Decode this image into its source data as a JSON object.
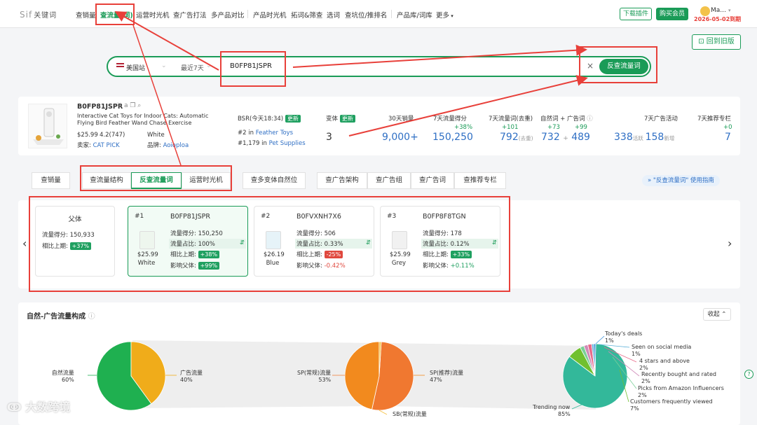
{
  "topbar": {
    "logo": "Sif",
    "logo_sub": "关键词",
    "nav": [
      "查销量",
      "查流量(词)",
      "运营时光机",
      "查广告打法",
      "多产品对比",
      "产品时光机",
      "拓词&筛查",
      "选词",
      "查坑位/推排名",
      "产品库/词库",
      "更多"
    ],
    "download": "下载插件",
    "buy": "购买会员",
    "user": "Ma...",
    "expire": "2026-05-02到期"
  },
  "back_old": "回到旧版",
  "search": {
    "site": "美国站",
    "range": "最近7天",
    "asin": "B0FP81JSPR",
    "submit": "反查流量词"
  },
  "product": {
    "asin": "B0FP81JSPR",
    "title": "Interactive Cat Toys for Indoor Cats: Automatic Flying Bird Feather Wand Chase Exercise Enrichment...",
    "price": "$25.99",
    "rating": "4.2(747)",
    "color": "White",
    "seller_label": "卖家:",
    "seller": "CAT PICK",
    "brand_label": "品牌:",
    "brand": "Aoioploa",
    "bsr_label": "BSR(今天18:34)",
    "bsr_update": "更新",
    "bsr1_rank": "#2",
    "bsr1_in": "in",
    "bsr1_cat": "Feather Toys",
    "bsr2_rank": "#1,179",
    "bsr2_in": "in",
    "bsr2_cat": "Pet Supplies",
    "variants_label": "变体",
    "variants_update": "更新",
    "variants": "3",
    "sales_label": "30天销量",
    "sales": "9,000+",
    "score_label": "7天流量得分",
    "score_change": "+38%",
    "score": "150,250",
    "kw_label": "7天流量词(去重)",
    "kw_change": "+101",
    "kw": "792",
    "kw_unit": "(去重)",
    "nat_label": "自然词 + 广告词",
    "nat_change": "+73",
    "ad_change": "+99",
    "nat": "732",
    "plus": "+",
    "ad": "489",
    "adact_label": "7天广告活动",
    "active": "338",
    "active_unit": "活跃",
    "new": "158",
    "new_unit": "新增",
    "rec_label": "7天推荐专栏",
    "rec_change": "+0",
    "rec": "7"
  },
  "tabs": [
    "查销量",
    "查流量结构",
    "反查流量词",
    "运营时光机",
    "查多变体自然位",
    "查广告架构",
    "查广告组",
    "查广告词",
    "查推荐专栏"
  ],
  "guide": "\"反查流量词\" 使用指南",
  "cards": {
    "parent": {
      "title": "父体",
      "score_label": "流量得分:",
      "score": "150,933",
      "cmp_label": "相比上期:",
      "cmp": "+37%"
    },
    "items": [
      {
        "idx": "#1",
        "asin": "B0FP81JSPR",
        "price": "$25.99",
        "color": "White",
        "score": "150,250",
        "share": "100%",
        "cmp": "+38%",
        "cmp_neg": false,
        "impact": "+99%",
        "impact_type": "pill"
      },
      {
        "idx": "#2",
        "asin": "B0FVXNH7X6",
        "price": "$26.19",
        "color": "Blue",
        "score": "506",
        "share": "0.33%",
        "cmp": "-25%",
        "cmp_neg": true,
        "impact": "-0.42%",
        "impact_type": "red"
      },
      {
        "idx": "#3",
        "asin": "B0FP8F8TGN",
        "price": "$25.99",
        "color": "Grey",
        "score": "178",
        "share": "0.12%",
        "cmp": "+33%",
        "cmp_neg": false,
        "impact": "+0.11%",
        "impact_type": "green"
      }
    ],
    "labels": {
      "score": "流量得分:",
      "share": "流量占比:",
      "cmp": "相比上期:",
      "impact": "影响父体:"
    }
  },
  "section": {
    "title": "自然-广告流量构成",
    "collapse": "收起"
  },
  "chart_data": [
    {
      "type": "pie",
      "slices": [
        {
          "label": "自然流量",
          "value": 60,
          "color": "#1fb050"
        },
        {
          "label": "广告流量",
          "value": 40,
          "color": "#f0ac1a"
        }
      ]
    },
    {
      "type": "pie",
      "slices": [
        {
          "label": "SP(常规)流量",
          "value": 53,
          "color": "#f07830"
        },
        {
          "label": "SP(推荐)流量",
          "value": 47,
          "color": "#f28a1e"
        },
        {
          "label": "SB(常规)流量",
          "value": 1,
          "color": "#f5c040"
        }
      ]
    },
    {
      "type": "pie",
      "slices": [
        {
          "label": "Trending now",
          "value": 85,
          "color": "#33b89a"
        },
        {
          "label": "Customers frequently viewed",
          "value": 7,
          "color": "#70c030"
        },
        {
          "label": "Picks from Amazon Influencers",
          "value": 2,
          "color": "#7ad098"
        },
        {
          "label": "Recently bought and rated",
          "value": 2,
          "color": "#d08ab8"
        },
        {
          "label": "4 stars and above",
          "value": 2,
          "color": "#e86a8a"
        },
        {
          "label": "Seen on social media",
          "value": 1,
          "color": "#5ab0d8"
        },
        {
          "label": "Today's deals",
          "value": 1,
          "color": "#3a8fd8"
        }
      ]
    }
  ],
  "pie_labels": {
    "p1a": "自然流量",
    "p1a_v": "60%",
    "p1b": "广告流量",
    "p1b_v": "40%",
    "p2a": "SP(常规)流量",
    "p2a_v": "53%",
    "p2b": "SP(推荐)流量",
    "p2b_v": "47%",
    "p2c": "SB(常规)流量",
    "p2c_v": "<1%",
    "td": "Today's deals",
    "td_v": "1%",
    "ss": "Seen on social media",
    "ss_v": "1%",
    "fs": "4 stars and above",
    "fs_v": "2%",
    "rb": "Recently bought and rated",
    "rb_v": "2%",
    "pa": "Picks from Amazon Influencers",
    "pa_v": "2%",
    "cf": "Customers frequently viewed",
    "cf_v": "7%",
    "tn": "Trending now",
    "tn_v": "85%"
  },
  "watermark": "大数跨境",
  "colors": {
    "accent": "#1a9b57",
    "red_annotation": "#e8403a"
  }
}
